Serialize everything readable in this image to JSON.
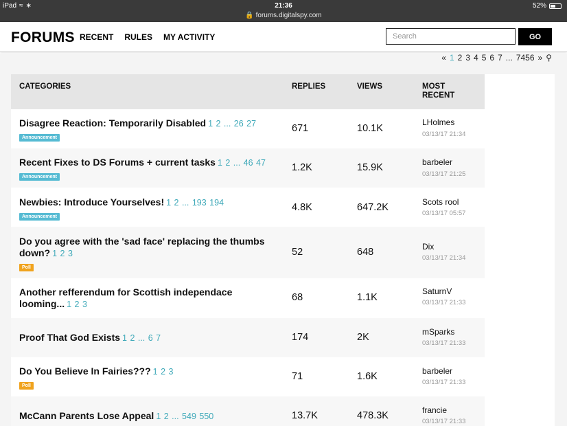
{
  "status": {
    "device": "iPad",
    "time": "21:36",
    "url": "forums.digitalspy.com",
    "battery": "52%",
    "battery_level": 0.52
  },
  "header": {
    "logo": "FORUMS",
    "nav": [
      "RECENT",
      "RULES",
      "MY ACTIVITY"
    ],
    "search_placeholder": "Search",
    "go_label": "GO"
  },
  "pager": {
    "prev": "«",
    "pages": [
      "1",
      "2",
      "3",
      "4",
      "5",
      "6",
      "7"
    ],
    "ellipsis": "...",
    "last": "7456",
    "next": "»"
  },
  "table": {
    "headers": {
      "categories": "CATEGORIES",
      "replies": "REPLIES",
      "views": "VIEWS",
      "most_recent_1": "MOST",
      "most_recent_2": "RECENT"
    },
    "rows": [
      {
        "title": "Disagree Reaction: Temporarily Disabled",
        "pages": "1 2 ... 26 27",
        "badge": "Announcement",
        "replies": "671",
        "views": "10.1K",
        "user": "LHolmes",
        "date": "03/13/17 21:34"
      },
      {
        "title": "Recent Fixes to DS Forums + current tasks",
        "pages": "1 2 ... 46 47",
        "badge": "Announcement",
        "replies": "1.2K",
        "views": "15.9K",
        "user": "barbeler",
        "date": "03/13/17 21:25"
      },
      {
        "title": "Newbies: Introduce Yourselves!",
        "pages": "1 2 ... 193 194",
        "badge": "Announcement",
        "replies": "4.8K",
        "views": "647.2K",
        "user": "Scots rool",
        "date": "03/13/17 05:57"
      },
      {
        "title": "Do you agree with the 'sad face' replacing the thumbs down?",
        "pages": "1 2 3",
        "badge": "Poll",
        "replies": "52",
        "views": "648",
        "user": "Dix",
        "date": "03/13/17 21:34"
      },
      {
        "title": "Another refferendum for Scottish independace looming...",
        "pages": "1 2 3",
        "badge": "",
        "replies": "68",
        "views": "1.1K",
        "user": "SaturnV",
        "date": "03/13/17 21:33"
      },
      {
        "title": "Proof That God Exists",
        "pages": "1 2 ... 6 7",
        "badge": "",
        "replies": "174",
        "views": "2K",
        "user": "mSparks",
        "date": "03/13/17 21:33"
      },
      {
        "title": "Do You Believe In Fairies???",
        "pages": "1 2 3",
        "badge": "Poll",
        "replies": "71",
        "views": "1.6K",
        "user": "barbeler",
        "date": "03/13/17 21:33"
      },
      {
        "title": "McCann Parents Lose Appeal",
        "pages": "1 2 ... 549 550",
        "badge": "",
        "replies": "13.7K",
        "views": "478.3K",
        "user": "francie",
        "date": "03/13/17 21:33"
      }
    ]
  }
}
